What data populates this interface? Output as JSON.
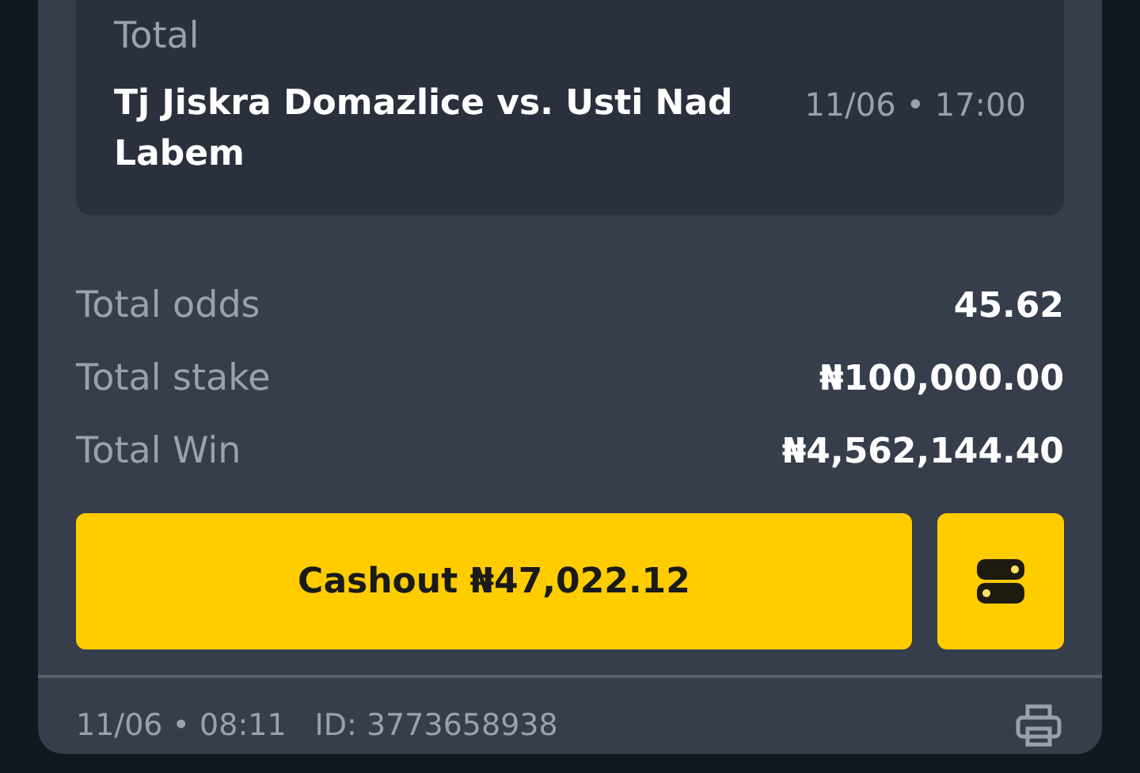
{
  "selection": {
    "market": "Total",
    "event": "Tj Jiskra Domazlice vs. Usti Nad Labem",
    "datetime": "11/06 • 17:00"
  },
  "summary": [
    {
      "label": "Total odds",
      "value": "45.62"
    },
    {
      "label": "Total stake",
      "value": "₦100,000.00"
    },
    {
      "label": "Total Win",
      "value": "₦4,562,144.40"
    }
  ],
  "cashout_button": "Cashout ₦47,022.12",
  "footer": {
    "datetime": "11/06 • 08:11",
    "id": "ID: 3773658938"
  }
}
